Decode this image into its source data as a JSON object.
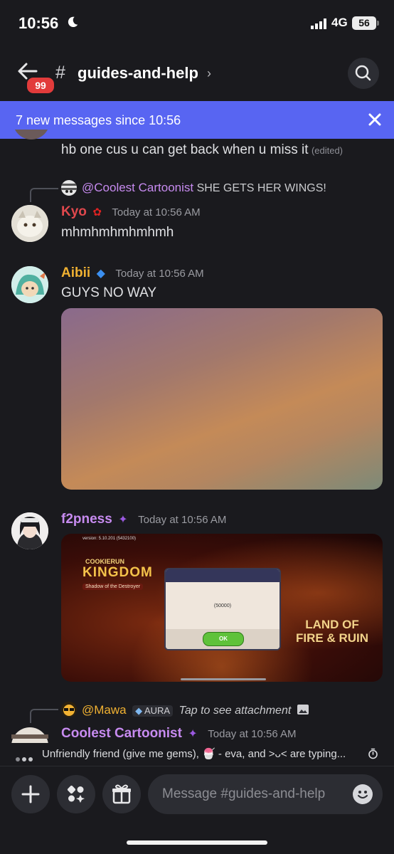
{
  "status_bar": {
    "time": "10:56",
    "network": "4G",
    "battery": "56"
  },
  "header": {
    "badge_count": "99",
    "channel_name": "guides-and-help"
  },
  "banner": {
    "text": "7 new messages since 10:56"
  },
  "messages": [
    {
      "text": "hb one cus u can get back when u miss it",
      "edited_label": "(edited)"
    },
    {
      "reply_mention": "@Coolest Cartoonist",
      "reply_text": "SHE GETS HER WINGS!",
      "username": "Kyo",
      "timestamp": "Today at 10:56 AM",
      "text": "mhmhmhmhmhmh",
      "username_color": "#e0484d"
    },
    {
      "username": "Aibii",
      "timestamp": "Today at 10:56 AM",
      "text": "GUYS NO WAY",
      "username_color": "#f0b132"
    },
    {
      "username": "f2pness",
      "timestamp": "Today at 10:56 AM",
      "username_color": "#c78bf0",
      "game_image": {
        "version": "version: 5.10.201 (5432100)",
        "logo_line1": "COOKIERUN",
        "logo_line2": "KINGDOM",
        "logo_sub": "Shadow of the Destroyer",
        "dialog_value": "(50000)",
        "ok_label": "OK",
        "title_line1": "LAND OF",
        "title_line2": "FIRE & RUIN"
      }
    },
    {
      "reply_mention": "@Mawa",
      "reply_tag": "AURA",
      "reply_text": "Tap to see attachment",
      "username": "Coolest Cartoonist",
      "timestamp": "Today at 10:56 AM",
      "username_color": "#c78bf0"
    }
  ],
  "typing": {
    "text": "Unfriendly friend (give me gems), 🍧 - eva, and >ᴗ< are typing..."
  },
  "composer": {
    "placeholder": "Message #guides-and-help"
  },
  "colors": {
    "accent": "#5865f2",
    "background": "#1a1a1e",
    "badge": "#e23b3b"
  },
  "icons": [
    "moon-icon",
    "signal-icon",
    "back-arrow-icon",
    "hash-icon",
    "chevron-right-icon",
    "search-icon",
    "close-icon",
    "rose-icon",
    "sparkle-badge-icon",
    "image-icon",
    "timer-icon",
    "plus-icon",
    "apps-icon",
    "gift-icon",
    "emoji-icon"
  ]
}
